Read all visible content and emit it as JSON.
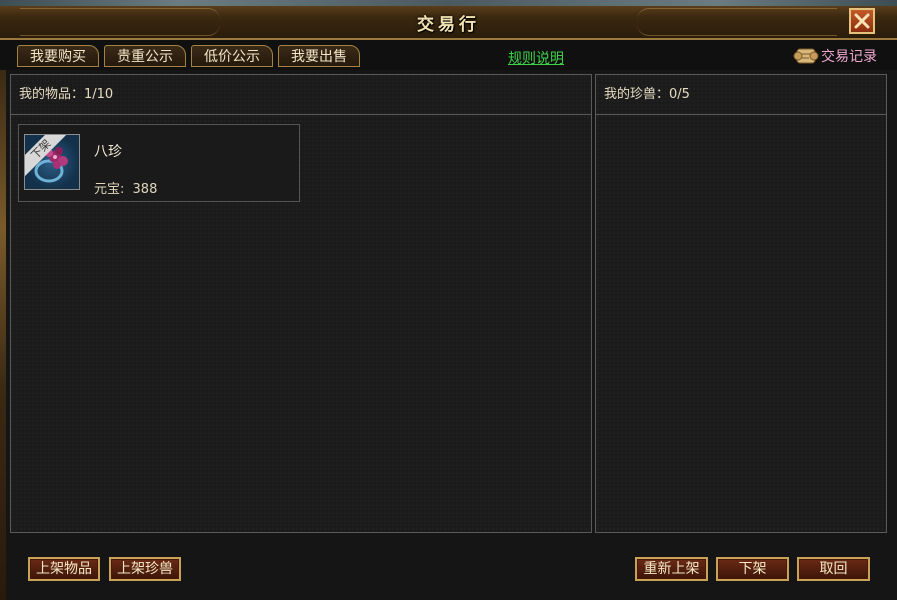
{
  "window": {
    "title": "交易行",
    "close_icon": "close-icon"
  },
  "tabs": [
    {
      "label": "我要购买"
    },
    {
      "label": "贵重公示"
    },
    {
      "label": "低价公示"
    },
    {
      "label": "我要出售"
    }
  ],
  "rules_link": "规则说明",
  "trade_record": {
    "label": "交易记录",
    "icon": "scroll-icon"
  },
  "my_items": {
    "header": "我的物品：1/10",
    "items": [
      {
        "name": "八珍",
        "price_label": "元宝:",
        "price": "388",
        "badge": "下架"
      }
    ]
  },
  "my_pets": {
    "header": "我的珍兽：0/5"
  },
  "buttons": {
    "list_item": "上架物品",
    "list_pet": "上架珍兽",
    "relist": "重新上架",
    "delist": "下架",
    "cancel": "取回"
  },
  "colors": {
    "accent_gold": "#c9a25a",
    "link_green": "#3fd14a",
    "record_pink": "#f0a8d0"
  }
}
